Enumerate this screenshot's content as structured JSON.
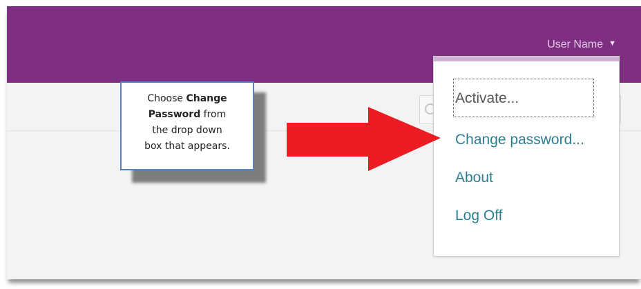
{
  "header": {
    "user_name": "User Name",
    "user_caret": "▼"
  },
  "search": {
    "icon": "search-icon"
  },
  "dropdown": {
    "items": [
      {
        "label": "Activate..."
      },
      {
        "label": "Change password..."
      },
      {
        "label": "About"
      },
      {
        "label": "Log Off"
      }
    ]
  },
  "callout": {
    "line1": "Choose ",
    "bold1": "Change",
    "bold2": "Password",
    "line2": " from",
    "line3": "the drop down",
    "line4": "box that appears."
  },
  "colors": {
    "topbar": "#7e2f82",
    "link": "#2b7f93",
    "arrow": "#ed1c24",
    "callout_border": "#4f83c4"
  }
}
